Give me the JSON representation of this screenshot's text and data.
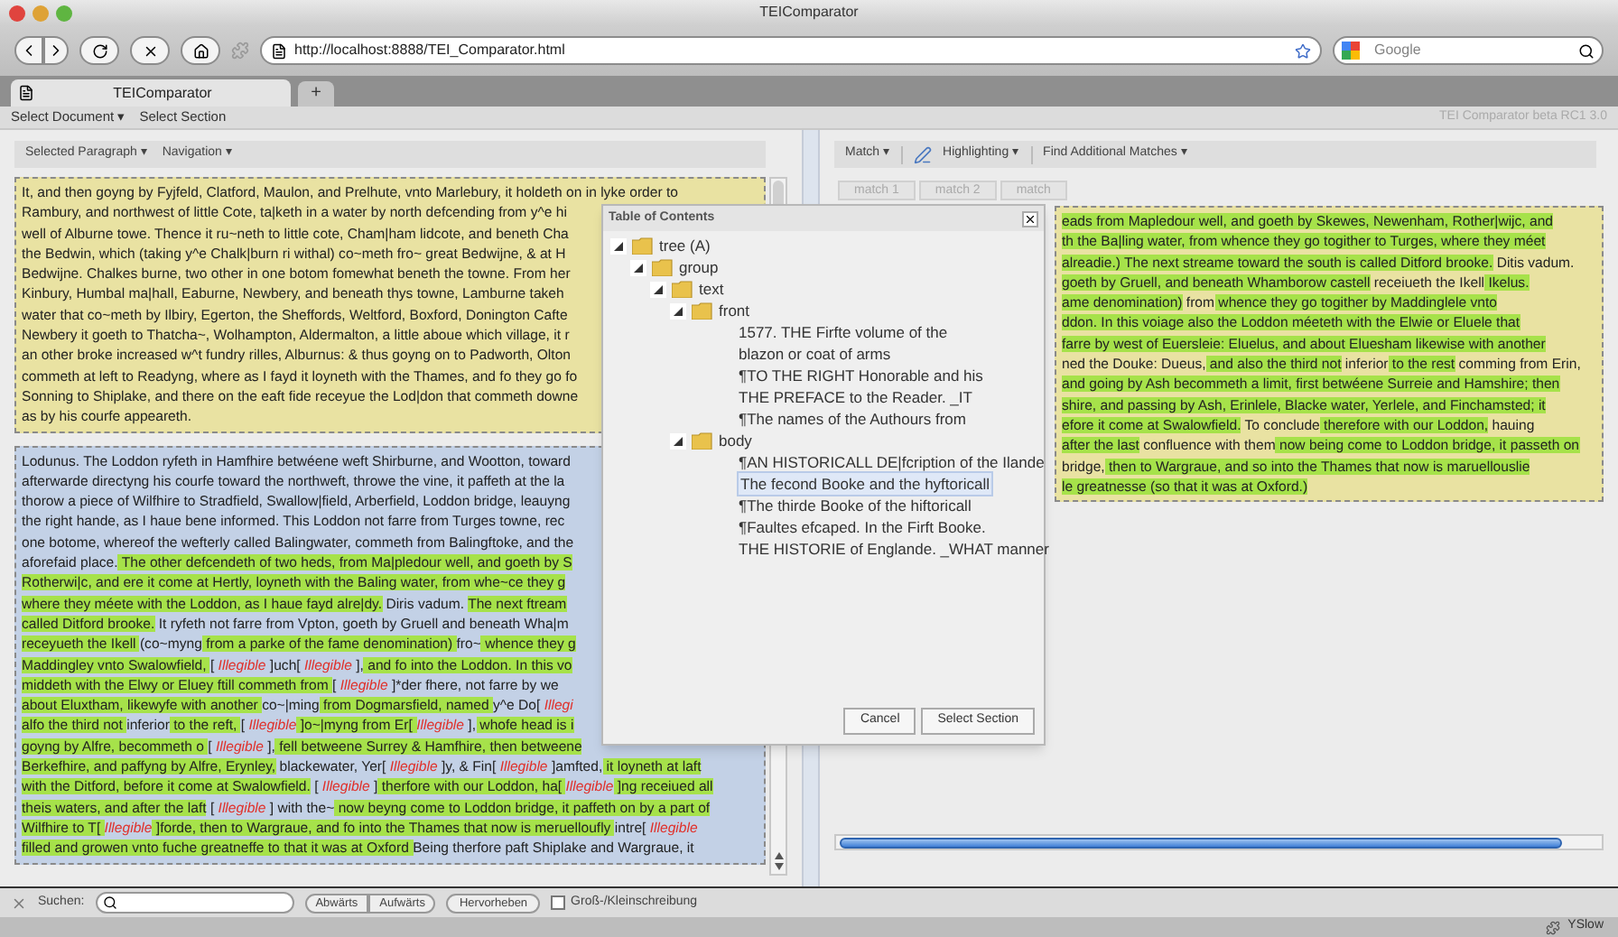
{
  "window": {
    "title": "TEIComparator"
  },
  "browser": {
    "url": "http://localhost:8888/TEI_Comparator.html",
    "search_placeholder": "Google",
    "tabs": [
      {
        "label": "TEIComparator",
        "selected": true
      }
    ],
    "new_tab": "+"
  },
  "app_menu": {
    "items": [
      "Select Document ▾",
      "Select Section"
    ],
    "version": "TEI Comparator beta RC1 3.0"
  },
  "left_panel": {
    "toolbar": [
      "Selected Paragraph ▾",
      "Navigation ▾"
    ],
    "paragraphs": [
      {
        "selected": false,
        "lines": [
          {
            "segments": [
              {
                "text": "It, and then goyng by Fyjfeld, Clatford, Maulon, and Prelhute, vnto Marlebury, it holdeth on in lyke order to",
                "kind": "plain"
              }
            ]
          },
          {
            "segments": [
              {
                "text": "Rambury, and northwest of little Cote, ta|keth in a water by north defcending from y^e hi",
                "kind": "plain"
              }
            ]
          },
          {
            "segments": [
              {
                "text": "well of Alburne towe. Thence it ru~neth to little cote, Cham|ham lidcote, and beneth Cha",
                "kind": "plain"
              }
            ]
          },
          {
            "segments": [
              {
                "text": "the Bedwin, which (taking y^e Chalk|burn ri withal) co~meth fro~ great Bedwijne, & at H",
                "kind": "plain"
              }
            ]
          },
          {
            "segments": [
              {
                "text": "Bedwijne. Chalkes burne, two other in one botom fomewhat beneth the towne. From her",
                "kind": "plain"
              }
            ]
          },
          {
            "segments": [
              {
                "text": "Kinbury, Humbal ma|hall, Eaburne, Newbery, and beneath thys towne, Lamburne takeh",
                "kind": "plain"
              }
            ]
          },
          {
            "segments": [
              {
                "text": "water that co~meth by Ilbiry, Egerton, the Sheffords, Weltford, Boxford, Donington Cafte",
                "kind": "plain"
              }
            ]
          },
          {
            "segments": [
              {
                "text": "Newbery it goeth to Thatcha~, Wolhampton, Aldermalton, a little aboue which village, it r",
                "kind": "plain"
              }
            ]
          },
          {
            "segments": [
              {
                "text": "an other broke increased w^t fundry rilles, Alburnus: & thus goyng on to Padworth, Olton",
                "kind": "plain"
              }
            ]
          },
          {
            "segments": [
              {
                "text": "commeth at left to Readyng, where as I fayd it loyneth with the Thames, and fo they go fo",
                "kind": "plain"
              }
            ]
          },
          {
            "segments": [
              {
                "text": "Sonning to Shiplake, and there on the eaft fide receyue the Lod|don that commeth downe",
                "kind": "plain"
              }
            ]
          },
          {
            "segments": [
              {
                "text": "as by his courfe appeareth.",
                "kind": "plain"
              }
            ]
          }
        ]
      },
      {
        "selected": true,
        "lines": [
          {
            "segments": [
              {
                "text": "Lodunus. The Loddon ryfeth in Hamfhire betwéene weft Shirburne, and Wootton, toward",
                "kind": "plain"
              }
            ]
          },
          {
            "segments": [
              {
                "text": "afterwarde directyng his courfe toward the northweft, throwe the vine, it paffeth at the la",
                "kind": "plain"
              }
            ]
          },
          {
            "segments": [
              {
                "text": "thorow a piece of Wilfhire to Stradfield, Swallow|field, Arberfield, Loddon bridge, leauyng",
                "kind": "plain"
              }
            ]
          },
          {
            "segments": [
              {
                "text": "the right hande, as I haue bene informed. This Loddon not farre from Turges towne, rec",
                "kind": "plain"
              }
            ]
          },
          {
            "segments": [
              {
                "text": "one botome, whereof the wefterly called Balingwater, commeth from Balingftoke, and the",
                "kind": "plain"
              }
            ]
          },
          {
            "segments": [
              {
                "text": "aforefaid place.",
                "kind": "plain"
              },
              {
                "text": " The other defcendeth of two heds, from Ma|pledour well, and goeth by S",
                "kind": "match"
              }
            ]
          },
          {
            "segments": [
              {
                "text": "Rotherwi|c, and ere it come at Hertly, loyneth with the Baling water, from whe~ce they g",
                "kind": "match"
              }
            ]
          },
          {
            "segments": [
              {
                "text": "where they méete with the Loddon, as I haue fayd alre|dy.",
                "kind": "match"
              },
              {
                "text": " Diris vadum. ",
                "kind": "plain"
              },
              {
                "text": "The next ftream",
                "kind": "match"
              }
            ]
          },
          {
            "segments": [
              {
                "text": "called Ditford brooke.",
                "kind": "match"
              },
              {
                "text": " It ryfeth not farre from Vpton, goeth by Gruell and beneath Wha|m",
                "kind": "plain"
              }
            ]
          },
          {
            "segments": [
              {
                "text": "receyueth the Ikell ",
                "kind": "match"
              },
              {
                "text": "(co~myng",
                "kind": "plain"
              },
              {
                "text": " from a parke of the fame denomination) ",
                "kind": "match"
              },
              {
                "text": "fro~",
                "kind": "plain"
              },
              {
                "text": " whence they g",
                "kind": "match"
              }
            ]
          },
          {
            "segments": [
              {
                "text": "Maddingley vnto Swalowfield, ",
                "kind": "match"
              },
              {
                "text": "[ ",
                "kind": "plain"
              },
              {
                "text": "Illegible",
                "kind": "illegible"
              },
              {
                "text": " ]uch[ ",
                "kind": "plain"
              },
              {
                "text": "Illegible",
                "kind": "illegible"
              },
              {
                "text": " ],",
                "kind": "plain"
              },
              {
                "text": " and fo into the Loddon. In this vo",
                "kind": "match"
              }
            ]
          },
          {
            "segments": [
              {
                "text": "middeth with the Elwy or Eluey ftill commeth from ",
                "kind": "match"
              },
              {
                "text": "[ ",
                "kind": "plain"
              },
              {
                "text": "Illegible",
                "kind": "illegible"
              },
              {
                "text": " ]*der fhere, not farre by we",
                "kind": "plain"
              }
            ]
          },
          {
            "segments": [
              {
                "text": "about Eluxtham, likewyfe with another ",
                "kind": "match"
              },
              {
                "text": "co~|ming",
                "kind": "plain"
              },
              {
                "text": " from Dogmarsfield, named ",
                "kind": "match"
              },
              {
                "text": "y^e Do[ ",
                "kind": "plain"
              },
              {
                "text": "Illegi",
                "kind": "illegible"
              }
            ]
          },
          {
            "segments": [
              {
                "text": "alfo the third not ",
                "kind": "match"
              },
              {
                "text": "inferior",
                "kind": "plain"
              },
              {
                "text": " to the reft, ",
                "kind": "match"
              },
              {
                "text": "[ ",
                "kind": "plain"
              },
              {
                "text": "Illegible",
                "kind": "illegible"
              },
              {
                "text": " ]o~|myng from Er[ ",
                "kind": "match"
              },
              {
                "text": "Illegible",
                "kind": "illegible"
              },
              {
                "text": " ],",
                "kind": "plain"
              },
              {
                "text": " whofe head is i",
                "kind": "match"
              }
            ]
          },
          {
            "segments": [
              {
                "text": "goyng by Alfre, becommeth o ",
                "kind": "match"
              },
              {
                "text": "[ ",
                "kind": "plain"
              },
              {
                "text": "Illegible",
                "kind": "illegible"
              },
              {
                "text": " ],",
                "kind": "plain"
              },
              {
                "text": " fell betweene Surrey & Hamfhire, then betweene",
                "kind": "match"
              }
            ]
          },
          {
            "segments": [
              {
                "text": "Berkefhire, and paffyng by Alfre, Erynley,",
                "kind": "match"
              },
              {
                "text": " blackewater, Yer[ ",
                "kind": "plain"
              },
              {
                "text": "Illegible",
                "kind": "illegible"
              },
              {
                "text": " ]y, & Fin[ ",
                "kind": "plain"
              },
              {
                "text": "Illegible",
                "kind": "illegible"
              },
              {
                "text": " ]amfted,",
                "kind": "plain"
              },
              {
                "text": " it loyneth at laft",
                "kind": "match"
              }
            ]
          },
          {
            "segments": [
              {
                "text": "with the Ditford, before it come at Swalowfield.",
                "kind": "match"
              },
              {
                "text": " [ ",
                "kind": "plain"
              },
              {
                "text": "Illegible",
                "kind": "illegible"
              },
              {
                "text": " ]",
                "kind": "plain"
              },
              {
                "text": " therfore with our Loddon, ha[ ",
                "kind": "match"
              },
              {
                "text": "Illegible",
                "kind": "illegible"
              },
              {
                "text": " ]ng receiued all",
                "kind": "match"
              }
            ]
          },
          {
            "segments": [
              {
                "text": "theis waters, and after the laft",
                "kind": "match"
              },
              {
                "text": " [ ",
                "kind": "plain"
              },
              {
                "text": "Illegible",
                "kind": "illegible"
              },
              {
                "text": " ] with the~",
                "kind": "plain"
              },
              {
                "text": " now beyng come to Loddon bridge, it paffeth on by a part of",
                "kind": "match"
              }
            ]
          },
          {
            "segments": [
              {
                "text": "Wilfhire to T[ ",
                "kind": "match"
              },
              {
                "text": "Illegible",
                "kind": "illegible"
              },
              {
                "text": " ]forde, then to Wargraue, and fo into the Thames that now is meruelloufly ",
                "kind": "match"
              },
              {
                "text": "intre[ ",
                "kind": "plain"
              },
              {
                "text": "Illegible",
                "kind": "illegible"
              }
            ]
          },
          {
            "segments": [
              {
                "text": "filled and growen vnto fuche greatneffe to that it was at Oxford ",
                "kind": "match"
              },
              {
                "text": "Being therfore paft Shiplake and Wargraue, it",
                "kind": "plain"
              }
            ]
          }
        ]
      }
    ]
  },
  "right_panel": {
    "toolbar": [
      "Match ▾",
      "Highlighting ▾",
      "Find Additional Matches ▾"
    ],
    "match_tabs": [
      {
        "label": "match 1",
        "selected": false
      },
      {
        "label": "match 2",
        "selected": false
      },
      {
        "label": "match",
        "selected": false
      }
    ],
    "paragraphs": [
      {
        "selected": false,
        "lines": [
          {
            "segments": [
              {
                "text": "eads from Mapledour well, and goeth by Skewes, Newenham, Rother|wijc, and",
                "kind": "match"
              }
            ]
          },
          {
            "segments": [
              {
                "text": "th the Ba|ling water, from whence they go togither to Turges, where they méet",
                "kind": "match"
              }
            ]
          },
          {
            "segments": [
              {
                "text": "alreadie.) The next streame toward the south is called Ditford brooke.",
                "kind": "match"
              },
              {
                "text": " Ditis vadum.",
                "kind": "plain"
              }
            ]
          },
          {
            "segments": [
              {
                "text": "goeth by Gruell, and beneath Whamborow castell",
                "kind": "match"
              },
              {
                "text": " receiueth the Ikell",
                "kind": "plain"
              },
              {
                "text": " Ikelus.",
                "kind": "match"
              }
            ]
          },
          {
            "segments": [
              {
                "text": "ame denomination)",
                "kind": "match"
              },
              {
                "text": " from",
                "kind": "plain"
              },
              {
                "text": " whence they go togither by Maddinglele vnto",
                "kind": "match"
              }
            ]
          },
          {
            "segments": [
              {
                "text": "ddon. In this voiage also the Loddon méeteth with the Elwie or Eluele that",
                "kind": "match"
              }
            ]
          },
          {
            "segments": [
              {
                "text": "farre by west of Euersleie: Eluelus, and about Eluesham",
                "kind": "match"
              },
              {
                "text": " likewise with another",
                "kind": "match"
              }
            ]
          },
          {
            "segments": [
              {
                "text": "ned the Douke: Dueus,",
                "kind": "plain"
              },
              {
                "text": " and also the third not",
                "kind": "match"
              },
              {
                "text": " inferior",
                "kind": "plain"
              },
              {
                "text": " to the rest",
                "kind": "match"
              },
              {
                "text": " comming from Erin,",
                "kind": "plain"
              }
            ]
          },
          {
            "segments": [
              {
                "text": "and going by Ash becommeth a limit, first betwéene Surreie and Hamshire; then",
                "kind": "match"
              }
            ]
          },
          {
            "segments": [
              {
                "text": "shire, and passing by Ash, Erinlele, Blacke water, Yerlele, and Finchamsted; it",
                "kind": "match"
              }
            ]
          },
          {
            "segments": [
              {
                "text": "efore it come at Swalowfield.",
                "kind": "match"
              },
              {
                "text": " To conclude",
                "kind": "plain"
              },
              {
                "text": " therefore with our Loddon,",
                "kind": "match"
              },
              {
                "text": " hauing",
                "kind": "plain"
              }
            ]
          },
          {
            "segments": [
              {
                "text": "after the last",
                "kind": "match"
              },
              {
                "text": " confluence with them",
                "kind": "plain"
              },
              {
                "text": " now being come to Loddon bridge, it passeth on",
                "kind": "match"
              }
            ]
          },
          {
            "segments": [
              {
                "text": "bridge,",
                "kind": "plain"
              },
              {
                "text": " then to Wargraue, and so into the Thames that now is maruellouslie",
                "kind": "match"
              }
            ]
          },
          {
            "segments": [
              {
                "text": "le greatnesse (so that it was at Oxford.)",
                "kind": "match"
              }
            ]
          }
        ]
      }
    ]
  },
  "dialog": {
    "title": "Table of Contents",
    "tree": [
      {
        "kind": "folder",
        "label": "tree (A)",
        "expanded": true,
        "children": [
          {
            "kind": "folder",
            "label": "group",
            "expanded": true,
            "children": [
              {
                "kind": "folder",
                "label": "text",
                "expanded": true,
                "children": [
                  {
                    "kind": "folder",
                    "label": "front",
                    "expanded": true,
                    "children": [
                      {
                        "kind": "leaf",
                        "label": "1577. THE Firfte volume of the",
                        "selected": false
                      },
                      {
                        "kind": "leaf",
                        "label": "blazon or coat of arms",
                        "selected": false
                      },
                      {
                        "kind": "leaf",
                        "label": "¶TO THE RIGHT Honorable and his",
                        "selected": false
                      },
                      {
                        "kind": "leaf",
                        "label": "THE PREFACE to the Reader. _IT",
                        "selected": false
                      },
                      {
                        "kind": "leaf",
                        "label": "¶The names of the Authours from",
                        "selected": false
                      }
                    ]
                  },
                  {
                    "kind": "folder",
                    "label": "body",
                    "expanded": true,
                    "children": [
                      {
                        "kind": "leaf",
                        "label": "¶AN HISTORICALL DE|fcription of the Ilande",
                        "selected": false
                      },
                      {
                        "kind": "leaf",
                        "label": "The fecond Booke and the hyftoricall",
                        "selected": true
                      },
                      {
                        "kind": "leaf",
                        "label": "¶The thirde Booke of the hiftoricall",
                        "selected": false
                      },
                      {
                        "kind": "leaf",
                        "label": "¶Faultes efcaped. In the Firft Booke.",
                        "selected": false
                      },
                      {
                        "kind": "leaf",
                        "label": "THE HISTORIE of Englande. _WHAT manner",
                        "selected": false
                      }
                    ]
                  }
                ]
              }
            ]
          }
        ]
      }
    ],
    "buttons": [
      "Cancel",
      "Select Section"
    ]
  },
  "find_bar": {
    "label": "Suchen:",
    "buttons": [
      "Abwärts",
      "Aufwärts"
    ],
    "highlight": "Hervorheben",
    "match_case": {
      "label": "Groß-/Kleinschreibung",
      "checked": false
    }
  },
  "status_bar": {
    "text": "YSlow"
  }
}
